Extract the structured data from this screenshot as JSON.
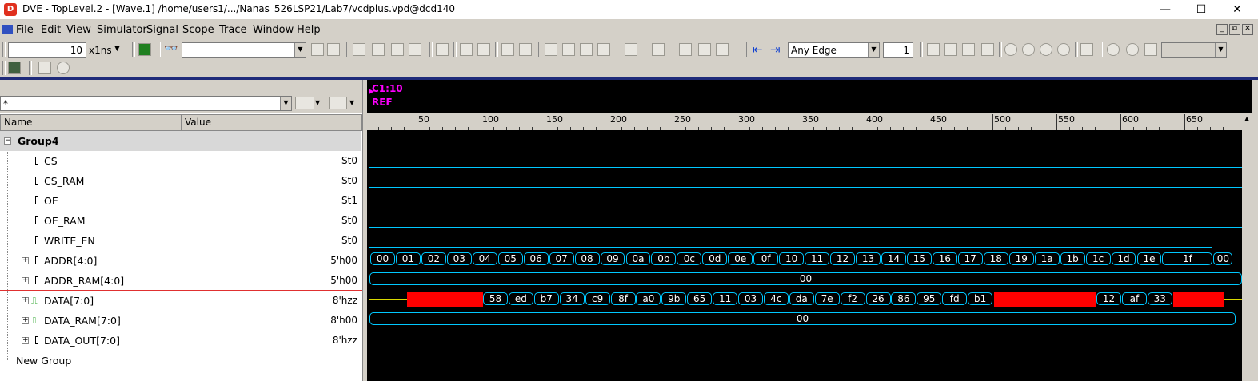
{
  "window": {
    "app_icon": "dve-app-icon",
    "title": "DVE - TopLevel.2 - [Wave.1]  /home/users1/.../Nanas_526LSP21/Lab7/vcdplus.vpd@dcd140",
    "minimize": "—",
    "maximize": "☐",
    "close": "✕"
  },
  "menubar": {
    "items": [
      "File",
      "Edit",
      "View",
      "Simulator",
      "Signal",
      "Scope",
      "Trace",
      "Window",
      "Help"
    ],
    "mdi_controls": [
      "_",
      "⧉",
      "✕"
    ]
  },
  "toolbar": {
    "time_value": "10",
    "time_unit": "x1ns",
    "search_value": "",
    "edge_select": "Any Edge",
    "edge_count": "1"
  },
  "filter": {
    "text": "*"
  },
  "columns": {
    "name": "Name",
    "value": "Value"
  },
  "cursor": {
    "c1": "C1:10",
    "ref": "REF"
  },
  "ruler": {
    "ticks": [
      "50",
      "100",
      "150",
      "200",
      "250",
      "300",
      "350",
      "400",
      "450",
      "500",
      "550",
      "600",
      "650"
    ]
  },
  "signals": [
    {
      "name": "Group4",
      "value": "",
      "kind": "group"
    },
    {
      "name": "CS",
      "value": "St0",
      "kind": "bit"
    },
    {
      "name": "CS_RAM",
      "value": "St0",
      "kind": "bit"
    },
    {
      "name": "OE",
      "value": "St1",
      "kind": "bit"
    },
    {
      "name": "OE_RAM",
      "value": "St0",
      "kind": "bit"
    },
    {
      "name": "WRITE_EN",
      "value": "St0",
      "kind": "bit"
    },
    {
      "name": "ADDR[4:0]",
      "value": "5'h00",
      "kind": "bus"
    },
    {
      "name": "ADDR_RAM[4:0]",
      "value": "5'h00",
      "kind": "bus"
    },
    {
      "name": "DATA[7:0]",
      "value": "8'hzz",
      "kind": "bus"
    },
    {
      "name": "DATA_RAM[7:0]",
      "value": "8'h00",
      "kind": "bus"
    },
    {
      "name": "DATA_OUT[7:0]",
      "value": "8'hzz",
      "kind": "bus"
    },
    {
      "name": "New Group",
      "value": "",
      "kind": "newgroup"
    }
  ],
  "waves": {
    "addr": [
      "00",
      "01",
      "02",
      "03",
      "04",
      "05",
      "06",
      "07",
      "08",
      "09",
      "0a",
      "0b",
      "0c",
      "0d",
      "0e",
      "0f",
      "10",
      "11",
      "12",
      "13",
      "14",
      "15",
      "16",
      "17",
      "18",
      "19",
      "1a",
      "1b",
      "1c",
      "1d",
      "1e",
      "1f",
      "00"
    ],
    "addr_ram": "00",
    "data": [
      "58",
      "ed",
      "b7",
      "34",
      "c9",
      "8f",
      "a0",
      "9b",
      "65",
      "11",
      "03",
      "4c",
      "da",
      "7e",
      "f2",
      "26",
      "86",
      "95",
      "fd",
      "b1",
      "12",
      "af",
      "33"
    ],
    "data_ram": "00"
  },
  "colors": {
    "cyan": "#00c8ff",
    "green": "#20c020",
    "yellow": "#d8d800",
    "red": "#ff0000",
    "magenta": "#ff00ff"
  }
}
